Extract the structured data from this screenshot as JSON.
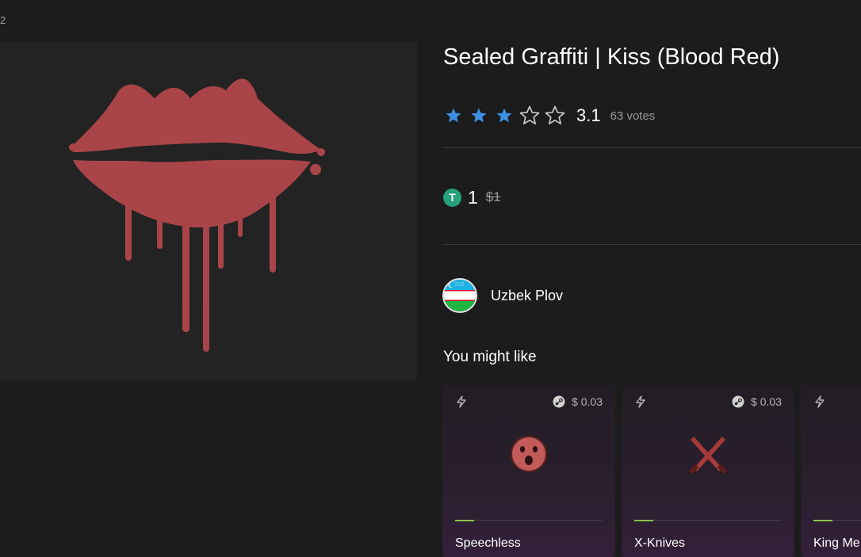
{
  "breadcrumb": "2",
  "product": {
    "title": "Sealed Graffiti | Kiss (Blood Red)",
    "image_icon": "kiss-lips-graffiti",
    "graffiti_color": "#b5484c"
  },
  "rating": {
    "value": "3.1",
    "votes": "63 votes",
    "stars_filled": 3,
    "stars_total": 5,
    "star_color": "#3d8fe0"
  },
  "price": {
    "currency_icon": "tether-icon",
    "currency_symbol": "T",
    "value": "1",
    "old_value": "$1",
    "currency_color": "#26a17b"
  },
  "seller": {
    "name": "Uzbek Plov",
    "avatar_icon": "uzbekistan-flag-icon"
  },
  "recommendations": {
    "heading": "You might like",
    "items": [
      {
        "name": "Speechless",
        "price": "$ 0.03",
        "icon": "speechless-graffiti"
      },
      {
        "name": "X-Knives",
        "price": "$ 0.03",
        "icon": "x-knives-graffiti"
      },
      {
        "name": "King Me",
        "price": "",
        "icon": "king-me-graffiti"
      }
    ]
  }
}
